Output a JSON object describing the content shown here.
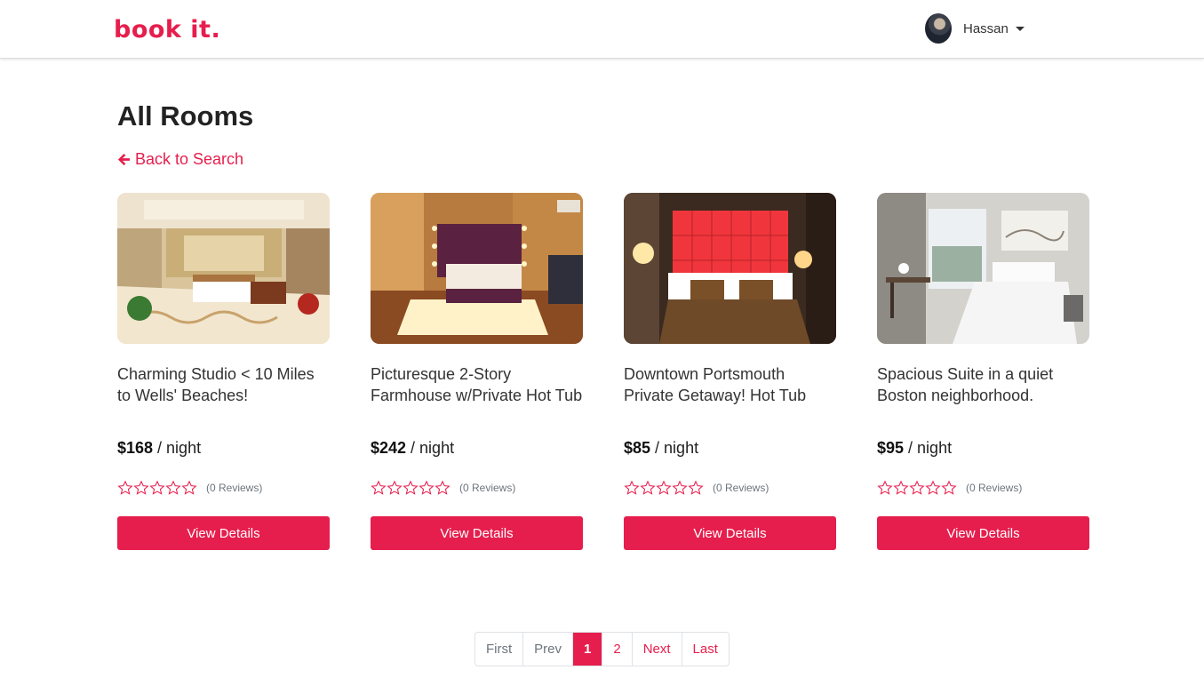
{
  "brand": {
    "logo_text": "book it.",
    "accent_color": "#e61e4d"
  },
  "user": {
    "name": "Hassan",
    "avatar_icon": "user-avatar"
  },
  "page": {
    "title": "All Rooms",
    "back_link": "Back to Search"
  },
  "rooms": [
    {
      "title": "Charming Studio < 10 Miles to Wells' Beaches!",
      "price": "$168",
      "per": " / night",
      "rating": 0,
      "reviews": "(0 Reviews)",
      "button": "View Details"
    },
    {
      "title": "Picturesque 2-Story Farmhouse w/Private Hot Tub",
      "price": "$242",
      "per": " / night",
      "rating": 0,
      "reviews": "(0 Reviews)",
      "button": "View Details"
    },
    {
      "title": "Downtown Portsmouth Private Getaway! Hot Tub",
      "price": "$85",
      "per": " / night",
      "rating": 0,
      "reviews": "(0 Reviews)",
      "button": "View Details"
    },
    {
      "title": "Spacious Suite in a quiet Boston neighborhood.",
      "price": "$95",
      "per": " / night",
      "rating": 0,
      "reviews": "(0 Reviews)",
      "button": "View Details"
    }
  ],
  "pagination": {
    "first": "First",
    "prev": "Prev",
    "pages": [
      "1",
      "2"
    ],
    "current": "1",
    "next": "Next",
    "last": "Last"
  }
}
